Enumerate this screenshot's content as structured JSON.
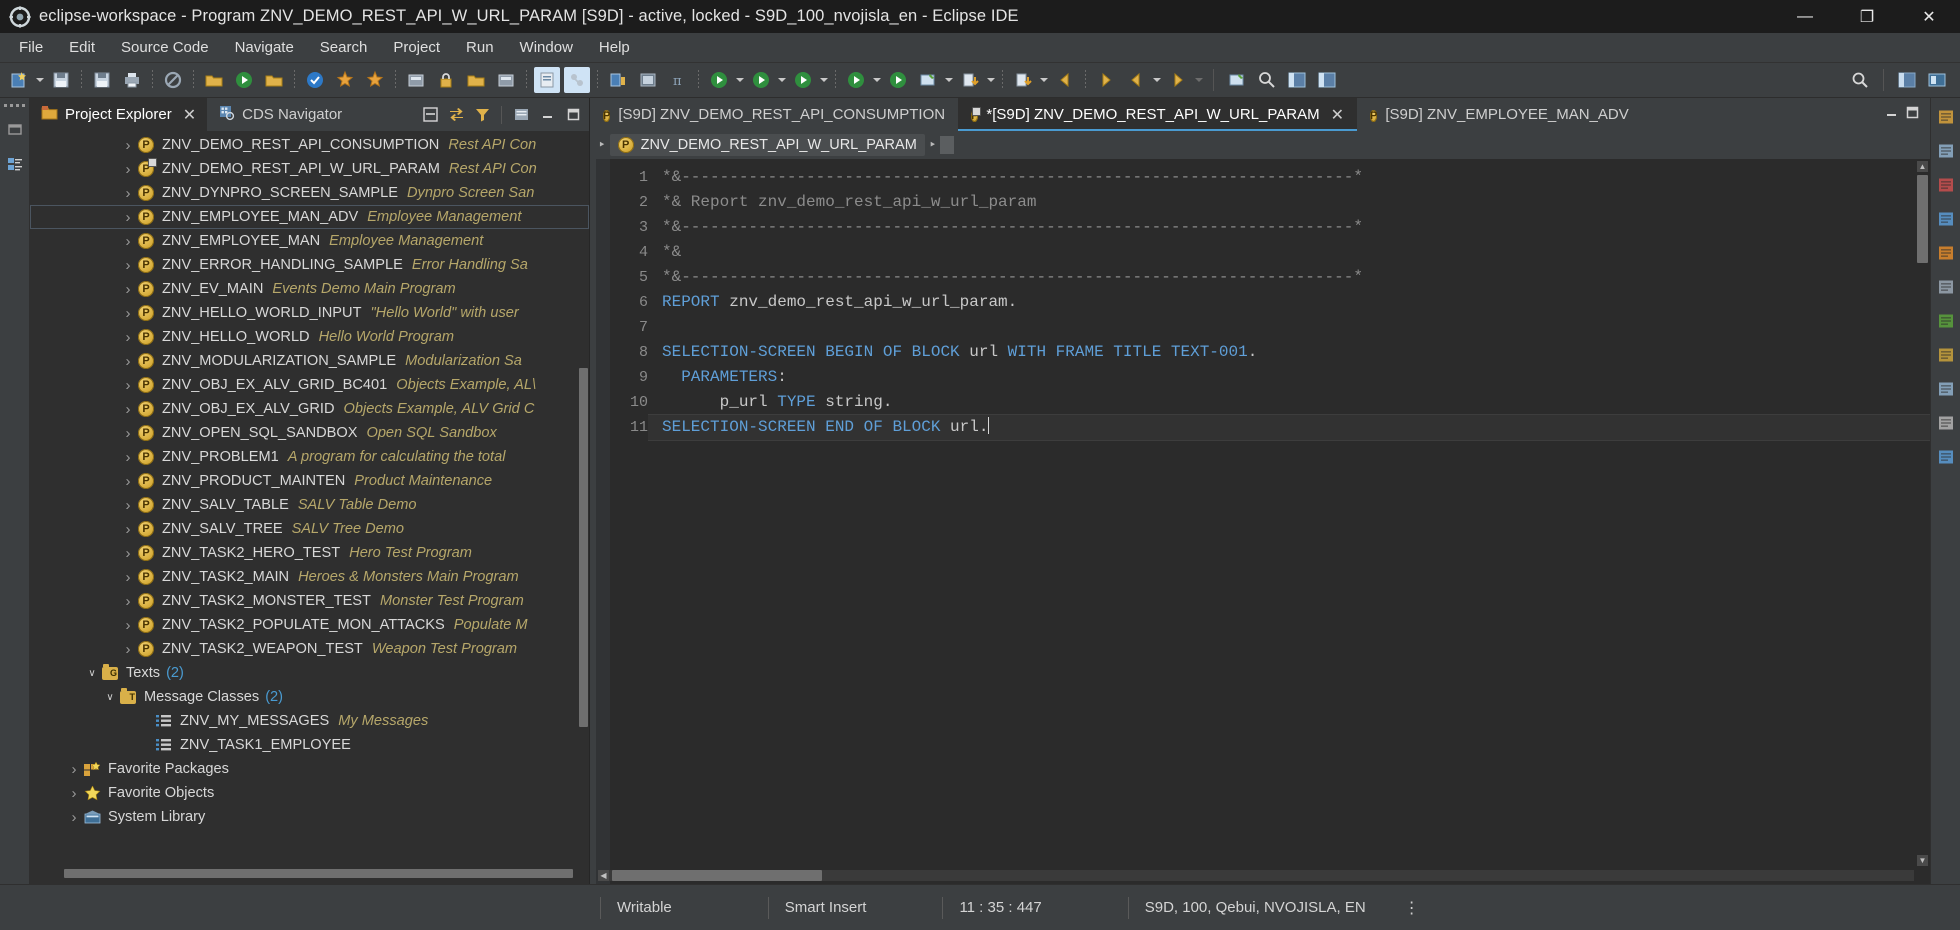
{
  "window": {
    "title": "eclipse-workspace - Program ZNV_DEMO_REST_API_W_URL_PARAM [S9D]  - active, locked - S9D_100_nvojisla_en - Eclipse IDE",
    "app_icon": "eclipse-icon",
    "minimize": "—",
    "maximize": "❐",
    "close": "✕"
  },
  "menubar": {
    "items": [
      {
        "label": "File",
        "name": "menu-file"
      },
      {
        "label": "Edit",
        "name": "menu-edit"
      },
      {
        "label": "Source Code",
        "name": "menu-source-code"
      },
      {
        "label": "Navigate",
        "name": "menu-navigate"
      },
      {
        "label": "Search",
        "name": "menu-search"
      },
      {
        "label": "Project",
        "name": "menu-project"
      },
      {
        "label": "Run",
        "name": "menu-run"
      },
      {
        "label": "Window",
        "name": "menu-window"
      },
      {
        "label": "Help",
        "name": "menu-help"
      }
    ]
  },
  "toolbar": {
    "icons": [
      "new-abap-object-icon",
      "save-icon",
      "save-all-icon",
      "print-icon",
      "no-entry-icon",
      "open-folder-icon",
      "run-green-icon",
      "open-abap-dev-object-icon",
      "check-blue-icon",
      "activate-star-icon",
      "activate-all-star-icon",
      "transport-organizer-icon",
      "lock-icon",
      "open-transport-icon",
      "abap-repository-icon",
      "abap-doc-icon",
      "abap-unit-icon",
      "link-editor-icon",
      "filmstrip-icon",
      "pi-icon",
      "debug-icon",
      "run-as-icon",
      "run-config-icon",
      "run-profile-icon",
      "abap-profiling-icon",
      "quickfix-icon",
      "export-icon",
      "import-icon",
      "back-arrow-icon",
      "forward-arrow-icon",
      "prev-arrow-icon",
      "next-arrow-icon",
      "new-window-icon",
      "search-icon",
      "perspective-icon",
      "perspective2-icon"
    ],
    "right_icons": [
      "search-icon",
      "open-perspective-icon",
      "abap-perspective-icon"
    ]
  },
  "explorer": {
    "tabs": [
      {
        "label": "Project Explorer",
        "icon": "project-explorer-icon",
        "selected": true,
        "closable": true
      },
      {
        "label": "CDS Navigator",
        "icon": "cds-navigator-icon",
        "selected": false,
        "closable": false
      }
    ],
    "tools": [
      "collapse-all-icon",
      "link-with-editor-icon",
      "filter-icon",
      "view-menu-icon"
    ],
    "view_buttons": [
      "minimize-icon",
      "maximize-icon"
    ],
    "tree": [
      {
        "indent": 3,
        "chev": "right",
        "icon": "package-icon",
        "name": "ZNV_DEMO_REST_API_CONSUMPTION",
        "desc": "Rest API Con"
      },
      {
        "indent": 3,
        "chev": "right",
        "icon": "package-lock-icon",
        "name": "ZNV_DEMO_REST_API_W_URL_PARAM",
        "desc": "Rest API Con"
      },
      {
        "indent": 3,
        "chev": "right",
        "icon": "package-icon",
        "name": "ZNV_DYNPRO_SCREEN_SAMPLE",
        "desc": "Dynpro Screen San"
      },
      {
        "indent": 3,
        "chev": "right",
        "icon": "package-icon",
        "name": "ZNV_EMPLOYEE_MAN_ADV",
        "desc": "Employee Management",
        "outlined": true
      },
      {
        "indent": 3,
        "chev": "right",
        "icon": "package-icon",
        "name": "ZNV_EMPLOYEE_MAN",
        "desc": "Employee Management"
      },
      {
        "indent": 3,
        "chev": "right",
        "icon": "package-icon",
        "name": "ZNV_ERROR_HANDLING_SAMPLE",
        "desc": "Error Handling Sa"
      },
      {
        "indent": 3,
        "chev": "right",
        "icon": "package-icon",
        "name": "ZNV_EV_MAIN",
        "desc": "Events Demo Main Program"
      },
      {
        "indent": 3,
        "chev": "right",
        "icon": "package-icon",
        "name": "ZNV_HELLO_WORLD_INPUT",
        "desc": "\"Hello World\" with user"
      },
      {
        "indent": 3,
        "chev": "right",
        "icon": "package-icon",
        "name": "ZNV_HELLO_WORLD",
        "desc": "Hello World Program"
      },
      {
        "indent": 3,
        "chev": "right",
        "icon": "package-icon",
        "name": "ZNV_MODULARIZATION_SAMPLE",
        "desc": "Modularization Sa"
      },
      {
        "indent": 3,
        "chev": "right",
        "icon": "package-icon",
        "name": "ZNV_OBJ_EX_ALV_GRID_BC401",
        "desc": "Objects Example, AL\\"
      },
      {
        "indent": 3,
        "chev": "right",
        "icon": "package-icon",
        "name": "ZNV_OBJ_EX_ALV_GRID",
        "desc": "Objects Example, ALV Grid C"
      },
      {
        "indent": 3,
        "chev": "right",
        "icon": "package-icon",
        "name": "ZNV_OPEN_SQL_SANDBOX",
        "desc": "Open SQL Sandbox"
      },
      {
        "indent": 3,
        "chev": "right",
        "icon": "package-icon",
        "name": "ZNV_PROBLEM1",
        "desc": "A program for calculating the total"
      },
      {
        "indent": 3,
        "chev": "right",
        "icon": "package-icon",
        "name": "ZNV_PRODUCT_MAINTEN",
        "desc": "Product Maintenance"
      },
      {
        "indent": 3,
        "chev": "right",
        "icon": "package-icon",
        "name": "ZNV_SALV_TABLE",
        "desc": "SALV Table Demo"
      },
      {
        "indent": 3,
        "chev": "right",
        "icon": "package-icon",
        "name": "ZNV_SALV_TREE",
        "desc": "SALV Tree Demo"
      },
      {
        "indent": 3,
        "chev": "right",
        "icon": "package-icon",
        "name": "ZNV_TASK2_HERO_TEST",
        "desc": "Hero Test Program"
      },
      {
        "indent": 3,
        "chev": "right",
        "icon": "package-icon",
        "name": "ZNV_TASK2_MAIN",
        "desc": "Heroes & Monsters Main Program"
      },
      {
        "indent": 3,
        "chev": "right",
        "icon": "package-icon",
        "name": "ZNV_TASK2_MONSTER_TEST",
        "desc": "Monster Test Program"
      },
      {
        "indent": 3,
        "chev": "right",
        "icon": "package-icon",
        "name": "ZNV_TASK2_POPULATE_MON_ATTACKS",
        "desc": "Populate M"
      },
      {
        "indent": 3,
        "chev": "right",
        "icon": "package-icon",
        "name": "ZNV_TASK2_WEAPON_TEST",
        "desc": "Weapon Test Program"
      },
      {
        "indent": 1,
        "chev": "down",
        "icon": "texts-folder-icon",
        "name": "Texts",
        "count": "(2)",
        "plain": true
      },
      {
        "indent": 2,
        "chev": "down",
        "icon": "message-folder-icon",
        "name": "Message Classes",
        "count": "(2)",
        "plain": true
      },
      {
        "indent": 4,
        "chev": "none",
        "icon": "message-class-icon",
        "name": "ZNV_MY_MESSAGES",
        "desc": "My Messages"
      },
      {
        "indent": 4,
        "chev": "none",
        "icon": "message-class-icon",
        "name": "ZNV_TASK1_EMPLOYEE",
        "desc": ""
      },
      {
        "indent": 0,
        "chev": "right",
        "icon": "favorite-packages-icon",
        "name": "Favorite Packages",
        "plain": true
      },
      {
        "indent": 0,
        "chev": "right",
        "icon": "favorite-objects-icon",
        "name": "Favorite Objects",
        "plain": true
      },
      {
        "indent": 0,
        "chev": "right",
        "icon": "system-library-icon",
        "name": "System Library",
        "plain": true
      }
    ]
  },
  "editor": {
    "tabs": [
      {
        "label": "[S9D] ZNV_DEMO_REST_API_CONSUMPTION",
        "icon": "package-icon",
        "selected": false,
        "closable": false,
        "dirty": false
      },
      {
        "label": "*[S9D] ZNV_DEMO_REST_API_W_URL_PARAM",
        "icon": "package-lock-icon",
        "selected": true,
        "closable": true,
        "dirty": true
      },
      {
        "label": "[S9D] ZNV_EMPLOYEE_MAN_ADV",
        "icon": "package-icon",
        "selected": false,
        "closable": false,
        "dirty": false
      }
    ],
    "view_buttons": [
      "minimize-icon",
      "maximize-icon"
    ],
    "breadcrumb": {
      "lead_arrow": "‣",
      "item_icon": "package-icon",
      "item_label": "ZNV_DEMO_REST_API_W_URL_PARAM",
      "trail_arrow": "‣"
    },
    "code": {
      "lines": [
        {
          "n": "1",
          "segments": [
            {
              "t": "*&----------------------------------------------------------------------*",
              "c": "cm"
            }
          ]
        },
        {
          "n": "2",
          "segments": [
            {
              "t": "*& Report znv_demo_rest_api_w_url_param",
              "c": "cm"
            }
          ]
        },
        {
          "n": "3",
          "segments": [
            {
              "t": "*&----------------------------------------------------------------------*",
              "c": "cm"
            }
          ]
        },
        {
          "n": "4",
          "segments": [
            {
              "t": "*&",
              "c": "cm"
            }
          ]
        },
        {
          "n": "5",
          "segments": [
            {
              "t": "*&----------------------------------------------------------------------*",
              "c": "cm"
            }
          ]
        },
        {
          "n": "6",
          "segments": [
            {
              "t": "REPORT",
              "c": "kw"
            },
            {
              "t": " znv_demo_rest_api_w_url_param.",
              "c": ""
            }
          ]
        },
        {
          "n": "7",
          "segments": [
            {
              "t": "",
              "c": ""
            }
          ]
        },
        {
          "n": "8",
          "segments": [
            {
              "t": "SELECTION-SCREEN BEGIN OF BLOCK",
              "c": "kw"
            },
            {
              "t": " url ",
              "c": ""
            },
            {
              "t": "WITH FRAME TITLE TEXT-001",
              "c": "kw"
            },
            {
              "t": ".",
              "c": ""
            }
          ]
        },
        {
          "n": "9",
          "segments": [
            {
              "t": "  ",
              "c": ""
            },
            {
              "t": "PARAMETERS",
              "c": "kw"
            },
            {
              "t": ":",
              "c": ""
            }
          ]
        },
        {
          "n": "10",
          "segments": [
            {
              "t": "      p_url ",
              "c": ""
            },
            {
              "t": "TYPE",
              "c": "kw"
            },
            {
              "t": " string.",
              "c": ""
            }
          ]
        },
        {
          "n": "11",
          "segments": [
            {
              "t": "SELECTION-SCREEN END OF BLOCK",
              "c": "kw"
            },
            {
              "t": " url.",
              "c": ""
            }
          ],
          "current": true,
          "cursor": true
        }
      ]
    }
  },
  "right_rail": {
    "icons": [
      "outline-icon",
      "properties-icon",
      "problems-icon",
      "abap-console-icon",
      "feed-reader-icon",
      "templates-icon",
      "data-preview-icon",
      "transport-icon",
      "history-icon",
      "bookmarks-icon",
      "palette-icon"
    ]
  },
  "status": {
    "writable": "Writable",
    "insert_mode": "Smart Insert",
    "position": "11 : 35 : 447",
    "system": "S9D, 100, Qebui, NVOJISLA, EN",
    "overflow": "⋮"
  },
  "colors": {
    "accent": "#4a9bd1",
    "package_gold": "#c99a1e",
    "desc_italic": "#b6a76a",
    "keyword_blue": "#5f9fd8",
    "comment_gray": "#8c8c8c",
    "bg_dark": "#2b2b2b",
    "panel": "#3c3f41",
    "title_bg": "#1c1c1c"
  }
}
